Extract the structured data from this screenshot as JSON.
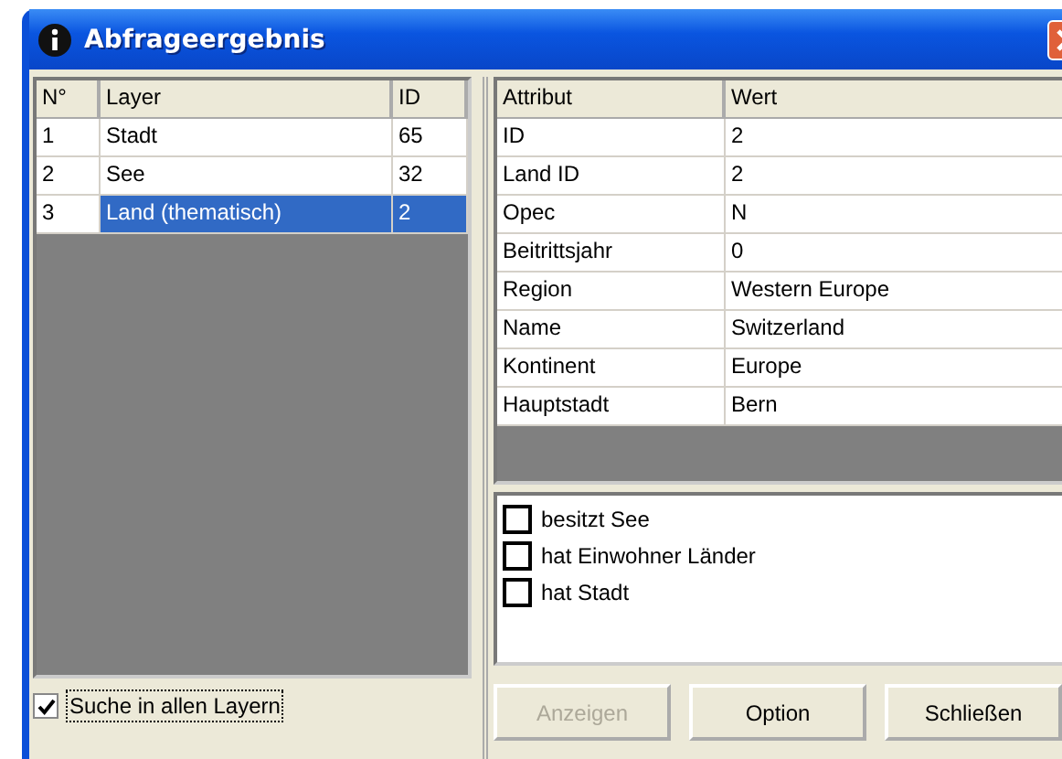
{
  "window": {
    "title": "Abfrageergebnis"
  },
  "layers": {
    "columns": [
      "N°",
      "Layer",
      "ID"
    ],
    "rows": [
      {
        "cells": [
          "1",
          "Stadt",
          "65"
        ],
        "selected": false
      },
      {
        "cells": [
          "2",
          "See",
          "32"
        ],
        "selected": false
      },
      {
        "cells": [
          "3",
          "Land (thematisch)",
          "2"
        ],
        "selected": true
      }
    ]
  },
  "search_all_layers": {
    "label": "Suche in allen Layern",
    "checked": true
  },
  "attributes": {
    "columns": [
      "Attribut",
      "Wert"
    ],
    "rows": [
      [
        "ID",
        "2"
      ],
      [
        "Land ID",
        "2"
      ],
      [
        "Opec",
        "N"
      ],
      [
        "Beitrittsjahr",
        "0"
      ],
      [
        "Region",
        "Western Europe"
      ],
      [
        "Name",
        "Switzerland"
      ],
      [
        "Kontinent",
        "Europe"
      ],
      [
        "Hauptstadt",
        "Bern"
      ]
    ]
  },
  "relations": [
    {
      "label": "besitzt See",
      "checked": false
    },
    {
      "label": "hat Einwohner Länder",
      "checked": false
    },
    {
      "label": "hat Stadt",
      "checked": false
    }
  ],
  "buttons": [
    {
      "label": "Anzeigen",
      "disabled": true
    },
    {
      "label": "Option",
      "disabled": false
    },
    {
      "label": "Schließen",
      "disabled": false
    }
  ]
}
